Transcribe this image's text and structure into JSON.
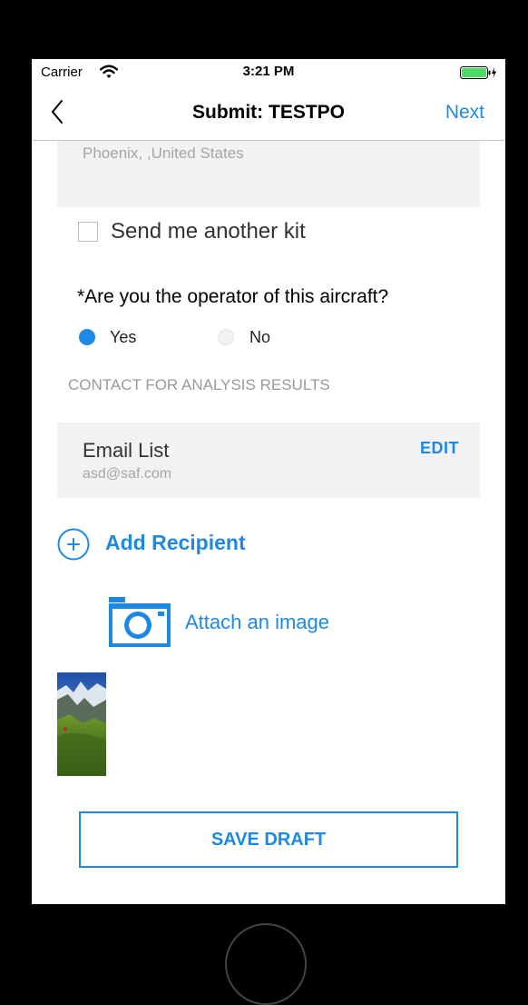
{
  "status_bar": {
    "carrier": "Carrier",
    "time": "3:21 PM"
  },
  "nav": {
    "title": "Submit: TESTPO",
    "next_label": "Next"
  },
  "address": {
    "text": "Phoenix, ,United States"
  },
  "kit": {
    "label": "Send me another kit",
    "checked": false
  },
  "operator": {
    "question": "*Are you the operator of this aircraft?",
    "options": [
      {
        "label": "Yes",
        "selected": true
      },
      {
        "label": "No",
        "selected": false
      }
    ]
  },
  "contact": {
    "heading": "CONTACT FOR ANALYSIS RESULTS"
  },
  "email": {
    "title": "Email List",
    "value": "asd@saf.com",
    "edit_label": "EDIT"
  },
  "add_recipient": {
    "label": "Add Recipient"
  },
  "attach": {
    "label": "Attach an image"
  },
  "save_draft": {
    "label": "SAVE DRAFT"
  },
  "colors": {
    "accent": "#1e88e5",
    "field_bg": "#f2f2f2",
    "muted_text": "#a5a5a5"
  }
}
